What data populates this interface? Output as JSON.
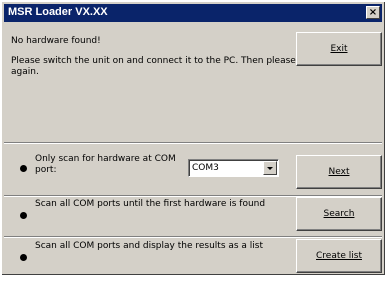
{
  "window": {
    "title": "MSR Loader VX.XX",
    "close_glyph": "×"
  },
  "message": {
    "line1": "No hardware found!",
    "line2": "Please switch the unit on and connect it to the PC. Then please try",
    "line3": "again."
  },
  "buttons": {
    "exit": "Exit",
    "next": "Next",
    "search": "Search",
    "create_list": "Create list"
  },
  "options": {
    "com_line1": "Only scan for hardware at COM",
    "com_line2": "port:",
    "scan_first": "Scan all COM ports until the first hardware is found",
    "scan_list": "Scan all COM ports and display the results as a list"
  },
  "port_select": {
    "value": "COM3"
  },
  "colors": {
    "titlebar": "#0a246a",
    "face": "#d4d0c8"
  }
}
